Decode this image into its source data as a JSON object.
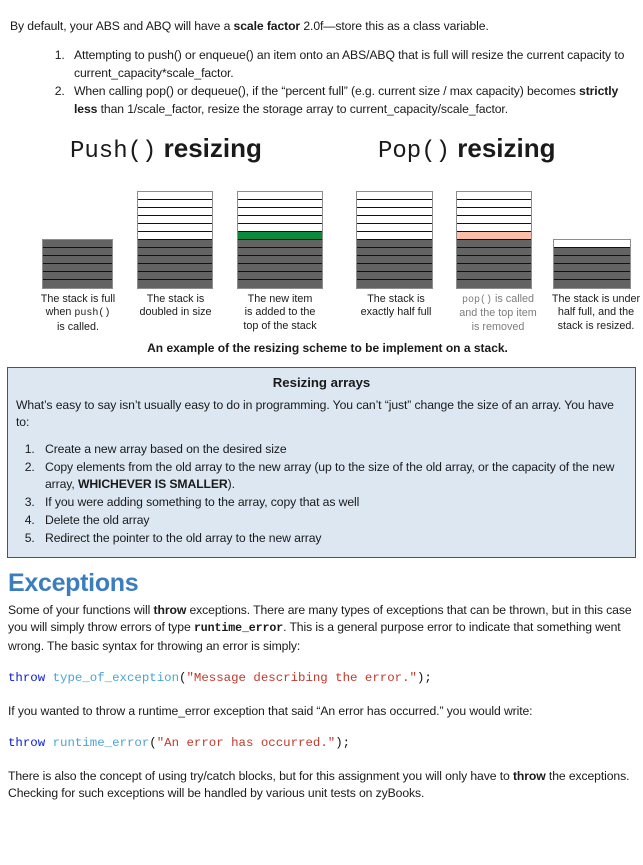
{
  "intro": {
    "before_bold": "By default, your ABS and ABQ will have a ",
    "bold": "scale factor",
    "after_bold": " 2.0f—store this as a class variable."
  },
  "top_list": [
    {
      "part1": "Attempting to push() or enqueue() an item onto an ABS/ABQ that is full will resize the current capacity to current_capacity*scale_factor.",
      "bold": "",
      "part2": ""
    },
    {
      "part1": "When calling pop() or dequeue(), if the “percent full” (e.g. current size / max capacity) becomes ",
      "bold": "strictly less",
      "part2": " than 1/scale_factor, resize the storage array to current_capacity/scale_factor."
    }
  ],
  "figure": {
    "push_title_mono": "Push()",
    "push_title_rest": " resizing",
    "pop_title_mono": "Pop()",
    "pop_title_rest": " resizing",
    "note": "An example of the resizing scheme to be implement on a stack.",
    "stacks": [
      {
        "id": "stack-full",
        "empty": 0,
        "filled": 6,
        "marker": "none",
        "marker_index": -1
      },
      {
        "id": "stack-doubled",
        "empty": 6,
        "filled": 6,
        "marker": "none",
        "marker_index": -1
      },
      {
        "id": "stack-item-added",
        "empty": 5,
        "filled": 6,
        "marker": "added",
        "marker_index": 5
      },
      {
        "id": "stack-half-full",
        "empty": 6,
        "filled": 6,
        "marker": "none",
        "marker_index": -1
      },
      {
        "id": "stack-item-removed",
        "empty": 5,
        "filled": 6,
        "marker": "removed",
        "marker_index": 5
      },
      {
        "id": "stack-resized",
        "empty": 1,
        "filled": 5,
        "marker": "none",
        "marker_index": -1
      }
    ],
    "captions": [
      {
        "lines": [
          "The stack is full",
          "when push() ",
          "is called."
        ],
        "mono_line": 1,
        "gray": false
      },
      {
        "lines": [
          "The stack is",
          "doubled in size"
        ],
        "mono_line": -1,
        "gray": false
      },
      {
        "lines": [
          "The new item",
          "is added to the",
          "top of the stack"
        ],
        "mono_line": -1,
        "gray": false
      },
      {
        "lines": [
          "The stack is",
          "exactly half full"
        ],
        "mono_line": -1,
        "gray": false
      },
      {
        "lines": [
          "pop() is called",
          "and the top item",
          "is removed"
        ],
        "mono_line": 0,
        "gray": true
      },
      {
        "lines": [
          "The stack is under",
          "half full, and the",
          "stack is resized."
        ],
        "mono_line": -1,
        "gray": false
      }
    ]
  },
  "callout": {
    "title": "Resizing arrays",
    "body": "What’s easy to say isn’t usually easy to do in programming. You can’t “just” change the size of an array. You have to:",
    "items": [
      {
        "part1": "Create a new array based on the desired size",
        "bold": "",
        "part2": ""
      },
      {
        "part1": "Copy elements from the old array to the new array (up to the size of the old array, or the capacity of the new array, ",
        "bold": "WHICHEVER IS SMALLER",
        "part2": ")."
      },
      {
        "part1": "If you were adding something to the array, copy that as well",
        "bold": "",
        "part2": ""
      },
      {
        "part1": "Delete the old array",
        "bold": "",
        "part2": ""
      },
      {
        "part1": "Redirect the pointer to the old array to the new array",
        "bold": "",
        "part2": ""
      }
    ],
    "colors": {
      "background": "#dce7f2",
      "border": "#2a5a96"
    }
  },
  "exceptions": {
    "heading": "Exceptions",
    "heading_color": "#3a7ebf",
    "para1_a": "Some of your functions will ",
    "para1_bold1": "throw",
    "para1_b": " exceptions. There are many types of exceptions that can be thrown, but in this case you will simply throw errors of type ",
    "para1_mono": "runtime_error",
    "para1_c": ". This is a general purpose error to indicate that something went wrong. The basic syntax for throwing an error is simply:",
    "code1": {
      "kw": "throw",
      "fn": "type_of_exception",
      "open": "(",
      "str": "\"Message describing the error.\"",
      "close": ");"
    },
    "para2": "If you wanted to throw a runtime_error exception that said “An error has occurred.” you would write:",
    "code2": {
      "kw": "throw",
      "fn": "runtime_error",
      "open": "(",
      "str": "\"An error has occurred.\"",
      "close": ");"
    },
    "para3_a": "There is also the concept of using try/catch blocks, but for this assignment you will only have to ",
    "para3_bold": "throw",
    "para3_b": " the exceptions. Checking for such exceptions will be handled by various unit tests on zyBooks.",
    "code_colors": {
      "keyword": "#0b20d0",
      "function": "#4da3d4",
      "string": "#c0392b",
      "punctuation": "#111111"
    }
  }
}
